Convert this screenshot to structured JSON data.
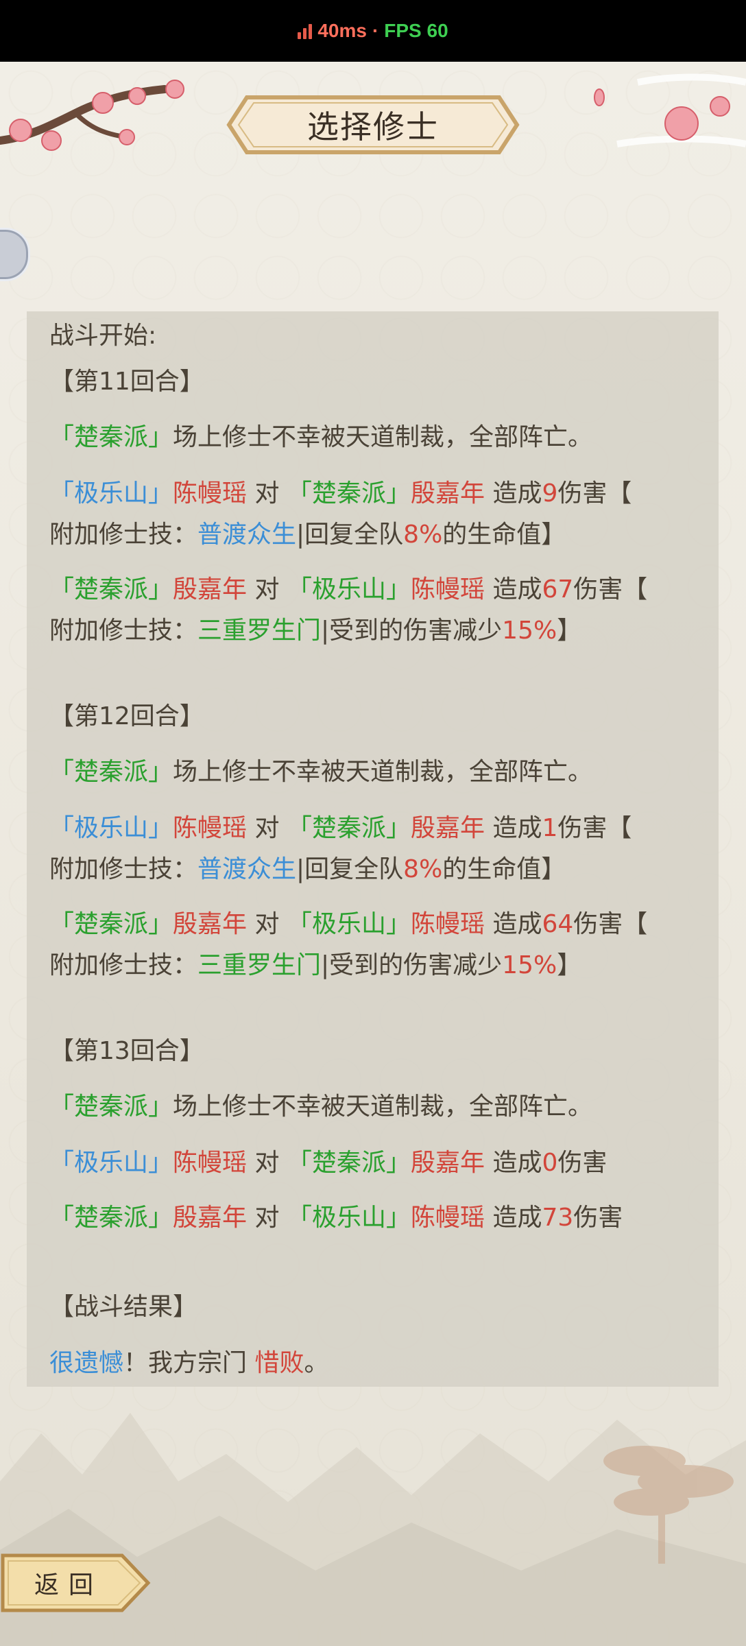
{
  "status": {
    "ping": "40ms",
    "separator": "·",
    "fps": "FPS 60"
  },
  "title": "选择修士",
  "log": {
    "start": "战斗开始:",
    "round11": "【第11回合】",
    "round12": "【第12回合】",
    "round13": "【第13回合】",
    "result_header": "【战斗结果】",
    "sect_chuqin": "「楚秦派」",
    "sect_jile": "「极乐山」",
    "wipe_text": "场上修士不幸被天道制裁，全部阵亡。",
    "name_chen": "陈幔瑶",
    "name_yin": "殷嘉年",
    "vs": "对",
    "deal": "造成",
    "damage": "伤害",
    "bracket_open": "【",
    "skill_prefix": "附加修士技：",
    "skill_pudu": "普渡众生",
    "skill_pudu_effect_a": "|回复全队",
    "skill_pudu_pct": "8%",
    "skill_pudu_effect_b": "的生命值】",
    "skill_sanchong": "三重罗生门",
    "skill_sanchong_effect": "|受到的伤害减少",
    "skill_sanchong_pct": "15%",
    "bracket_close": "】",
    "r11_dmg_a": "9",
    "r11_dmg_b": "67",
    "r12_dmg_a": "1",
    "r12_dmg_b": "64",
    "r13_dmg_a": "0",
    "r13_dmg_b": "73",
    "result_regret": "很遗憾",
    "result_mid": "！我方宗门 ",
    "result_lose": "惜败",
    "result_end": "。"
  },
  "back_button": "返回",
  "colors": {
    "green": "#2aa02e",
    "blue": "#3b8ed6",
    "red": "#d2453a",
    "text": "#4a4236"
  }
}
